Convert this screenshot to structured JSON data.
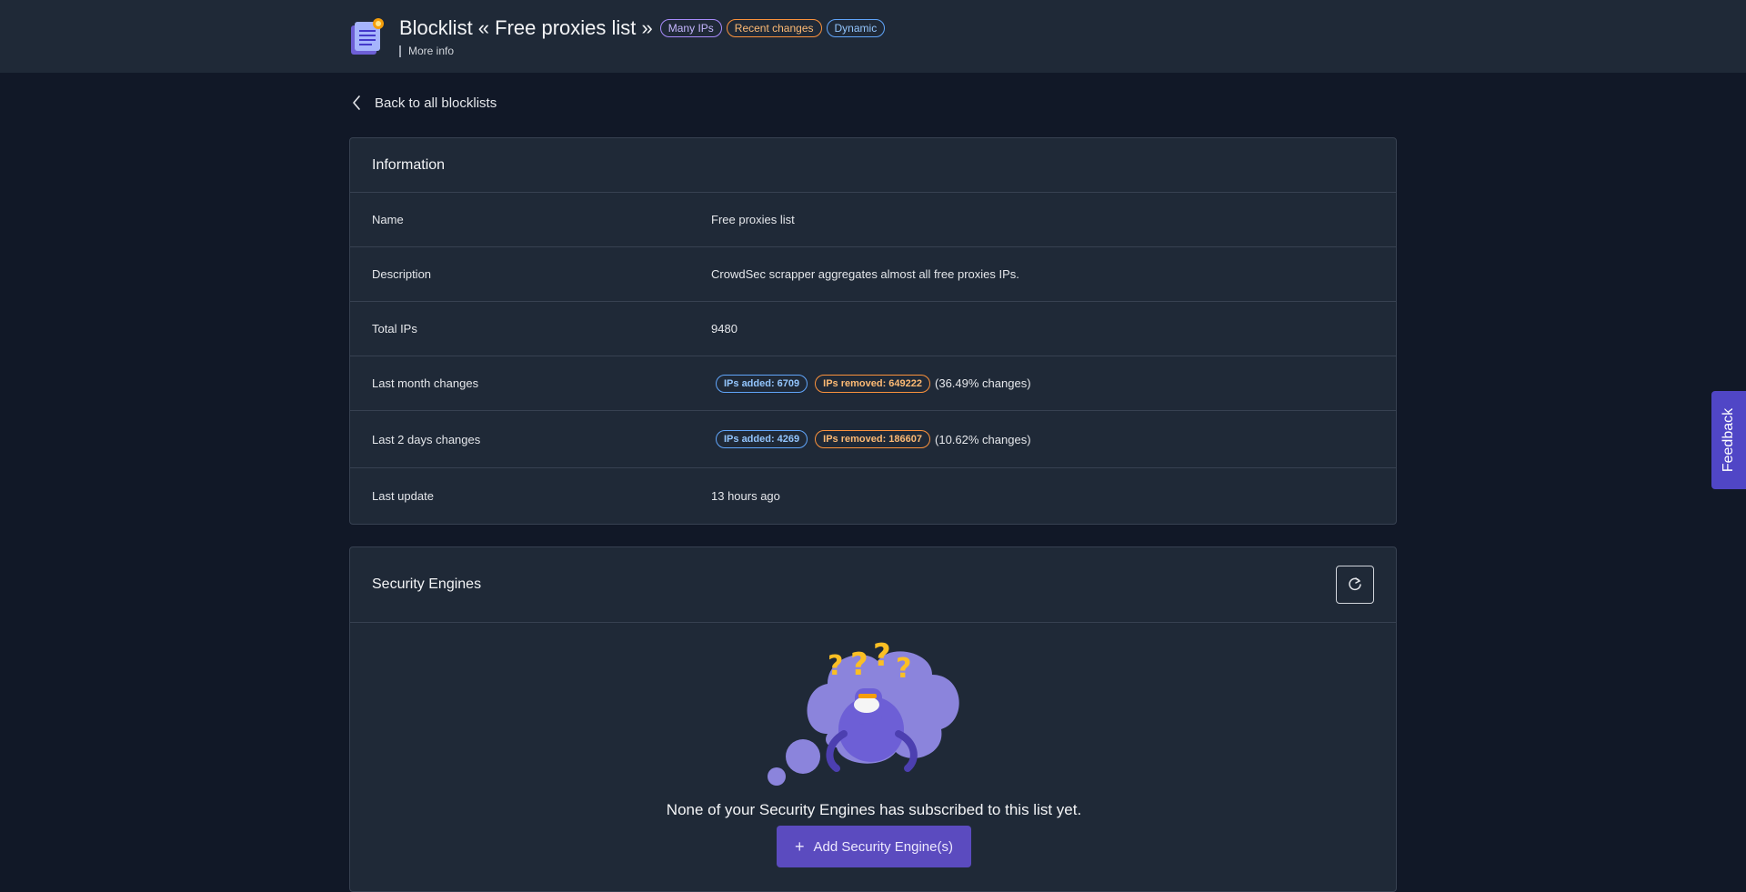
{
  "header": {
    "title": "Blocklist « Free proxies list »",
    "tags": [
      "Many IPs",
      "Recent changes",
      "Dynamic"
    ],
    "more_info": "More info",
    "icon": "list-document-icon"
  },
  "back_link": {
    "label": "Back to all blocklists",
    "icon": "chevron-left-icon"
  },
  "information": {
    "title": "Information",
    "rows": [
      {
        "label": "Name",
        "value": "Free proxies list"
      },
      {
        "label": "Description",
        "value": "CrowdSec scrapper aggregates almost all free proxies IPs."
      },
      {
        "label": "Total IPs",
        "value": "9480"
      },
      {
        "label": "Last month changes",
        "added": "IPs added: 6709",
        "removed": "IPs removed: 649222",
        "pct": "(36.49% changes)"
      },
      {
        "label": "Last 2 days changes",
        "added": "IPs added: 4269",
        "removed": "IPs removed: 186607",
        "pct": "(10.62% changes)"
      },
      {
        "label": "Last update",
        "value": "13 hours ago"
      }
    ]
  },
  "security_engines": {
    "title": "Security Engines",
    "refresh_icon": "refresh-icon",
    "empty_text": "None of your Security Engines has subscribed to this list yet.",
    "add_button": "Add Security Engine(s)"
  },
  "feedback": {
    "label": "Feedback"
  },
  "colors": {
    "background": "#111827",
    "card": "#1f2937",
    "accent": "#5b4bbf",
    "tag_purple": "#a78bfa",
    "tag_orange": "#fb923c",
    "tag_blue": "#60a5fa"
  }
}
